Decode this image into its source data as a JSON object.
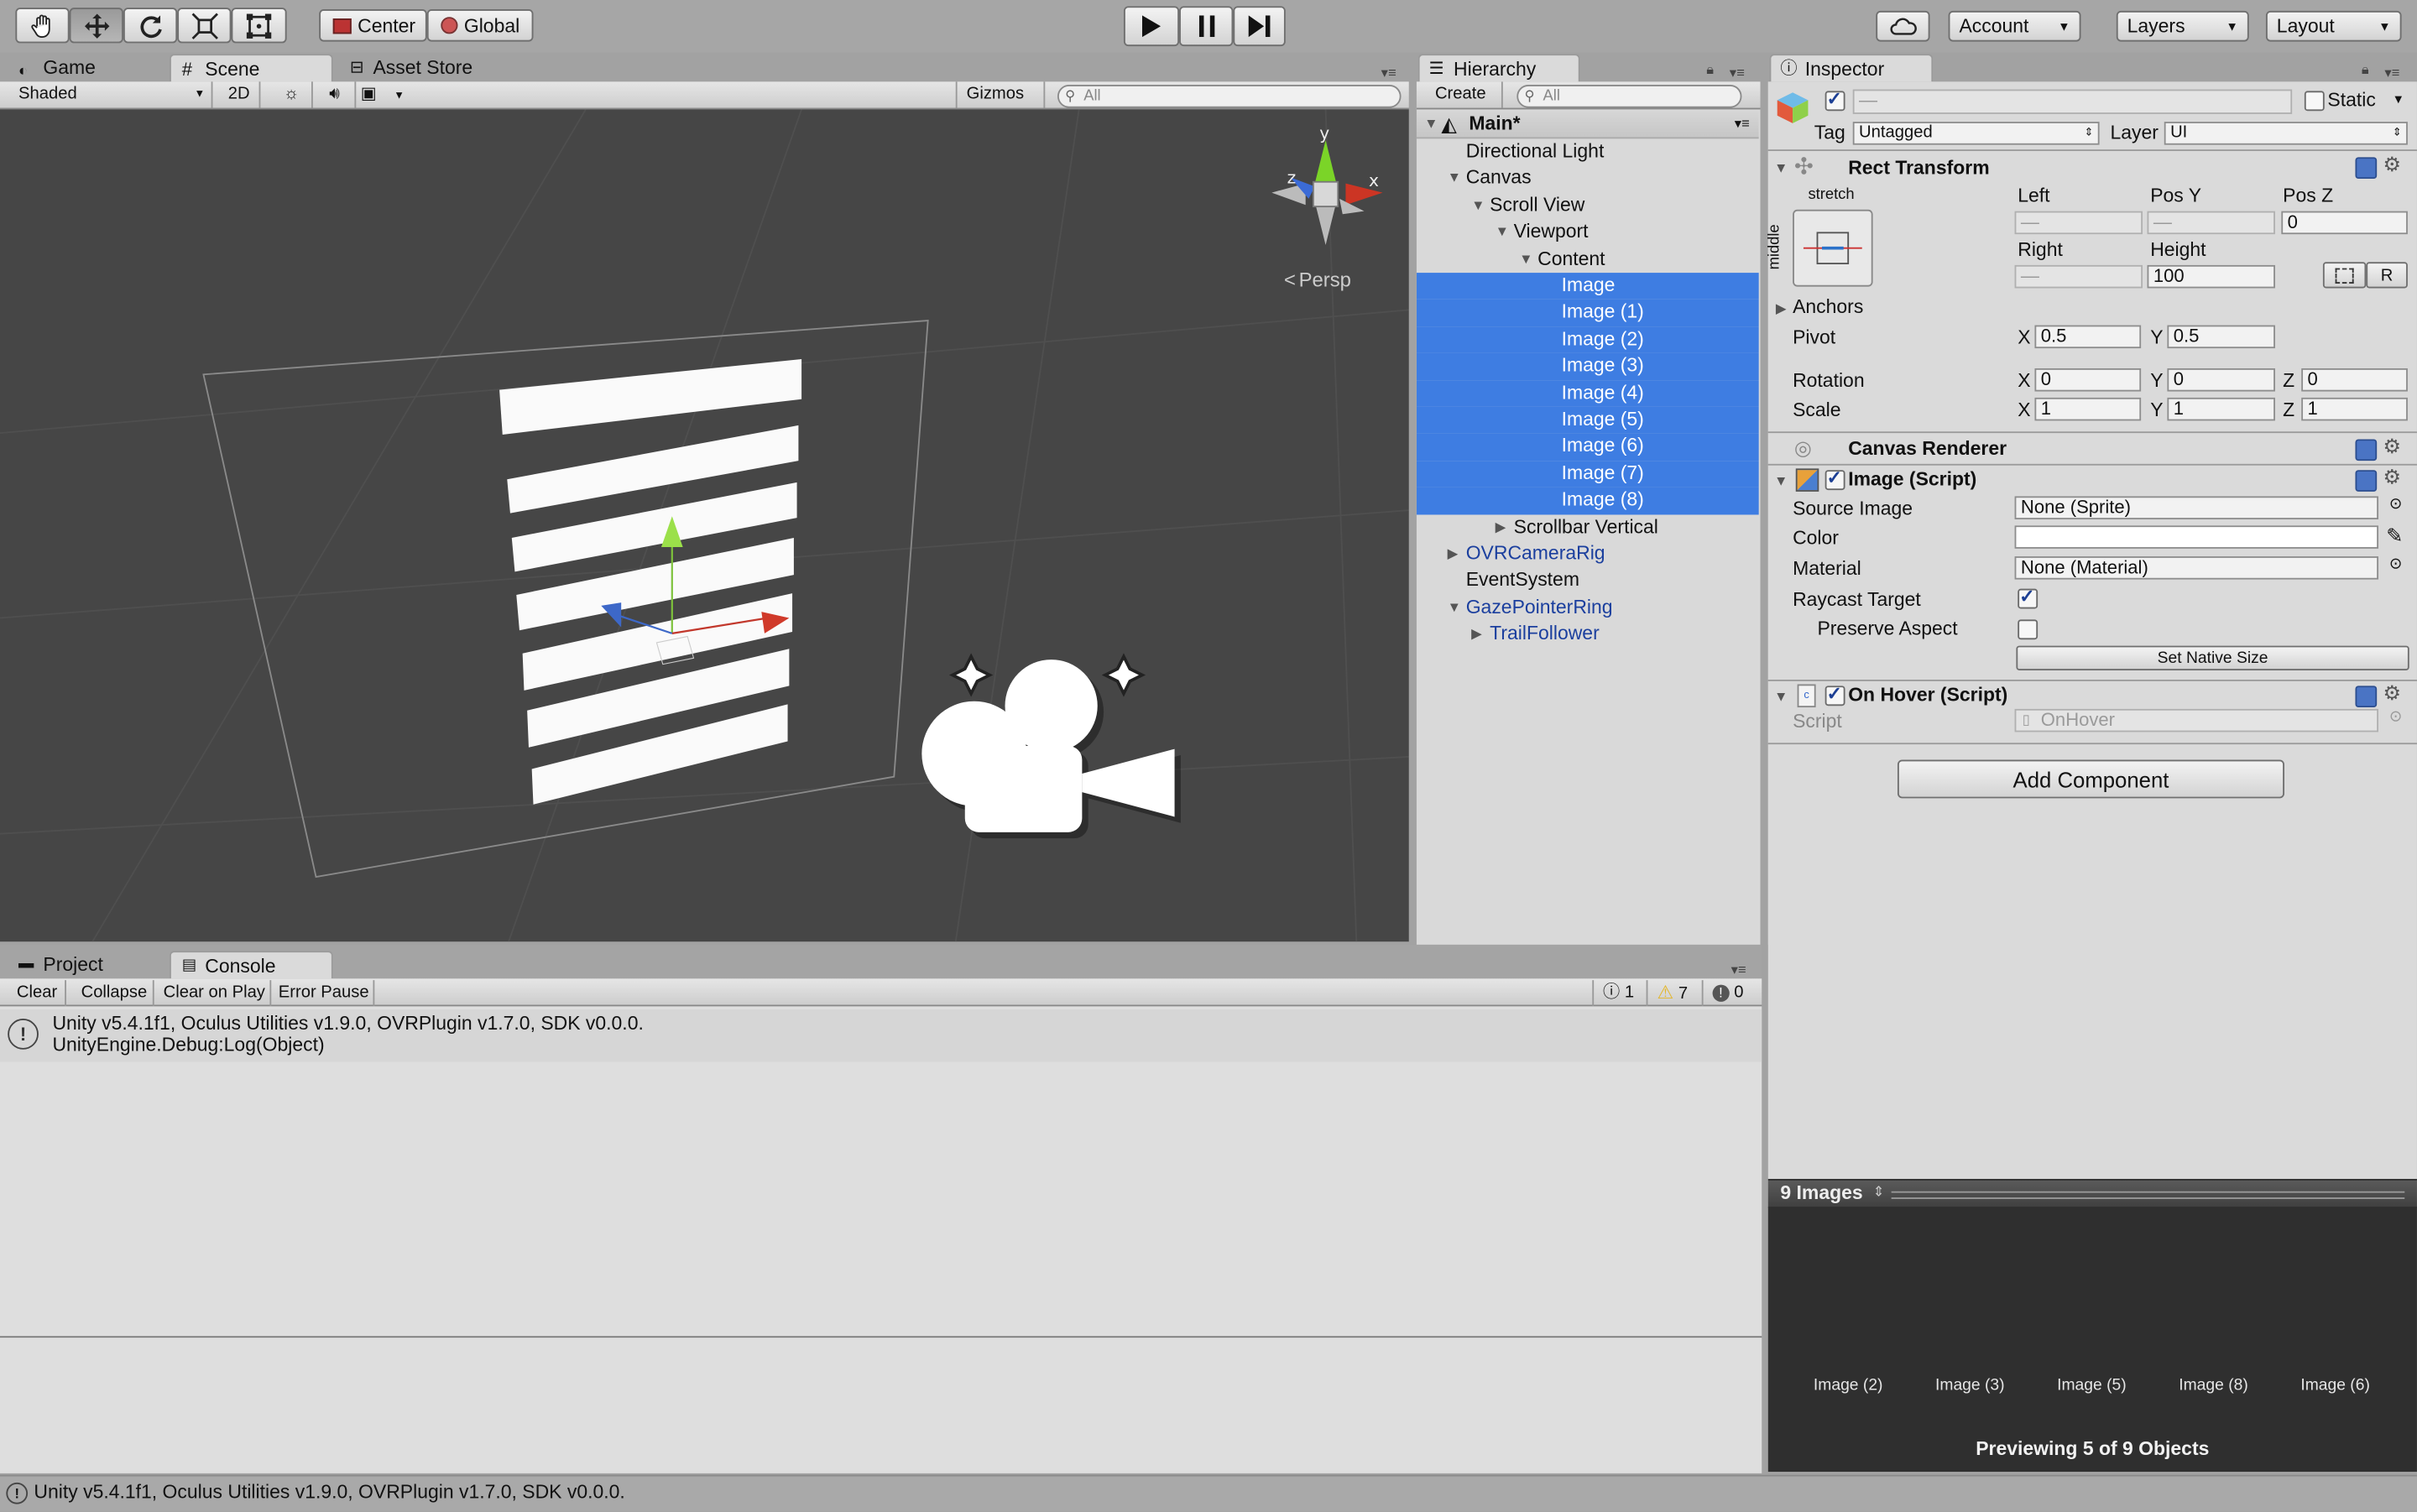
{
  "toolbar": {
    "pivot_label": "Center",
    "space_label": "Global",
    "account_label": "Account",
    "layers_label": "Layers",
    "layout_label": "Layout"
  },
  "scene_panel": {
    "tabs": [
      "Game",
      "Scene",
      "Asset Store"
    ],
    "shading_mode": "Shaded",
    "mode_2d": "2D",
    "gizmos_label": "Gizmos",
    "search_placeholder": "All",
    "persp_label": "Persp",
    "axis_labels": {
      "x": "x",
      "y": "y",
      "z": "z"
    }
  },
  "hierarchy": {
    "tab_label": "Hierarchy",
    "create_label": "Create",
    "search_placeholder": "All",
    "scene_name": "Main*",
    "items": [
      {
        "label": "Directional Light",
        "depth": 1,
        "expander": "",
        "selected": false,
        "prefab": false
      },
      {
        "label": "Canvas",
        "depth": 1,
        "expander": "open",
        "selected": false,
        "prefab": false
      },
      {
        "label": "Scroll View",
        "depth": 2,
        "expander": "open",
        "selected": false,
        "prefab": false
      },
      {
        "label": "Viewport",
        "depth": 3,
        "expander": "open",
        "selected": false,
        "prefab": false
      },
      {
        "label": "Content",
        "depth": 4,
        "expander": "open",
        "selected": false,
        "prefab": false
      },
      {
        "label": "Image",
        "depth": 5,
        "expander": "",
        "selected": true,
        "prefab": false
      },
      {
        "label": "Image (1)",
        "depth": 5,
        "expander": "",
        "selected": true,
        "prefab": false
      },
      {
        "label": "Image (2)",
        "depth": 5,
        "expander": "",
        "selected": true,
        "prefab": false
      },
      {
        "label": "Image (3)",
        "depth": 5,
        "expander": "",
        "selected": true,
        "prefab": false
      },
      {
        "label": "Image (4)",
        "depth": 5,
        "expander": "",
        "selected": true,
        "prefab": false
      },
      {
        "label": "Image (5)",
        "depth": 5,
        "expander": "",
        "selected": true,
        "prefab": false
      },
      {
        "label": "Image (6)",
        "depth": 5,
        "expander": "",
        "selected": true,
        "prefab": false
      },
      {
        "label": "Image (7)",
        "depth": 5,
        "expander": "",
        "selected": true,
        "prefab": false
      },
      {
        "label": "Image (8)",
        "depth": 5,
        "expander": "",
        "selected": true,
        "prefab": false
      },
      {
        "label": "Scrollbar Vertical",
        "depth": 3,
        "expander": "closed",
        "selected": false,
        "prefab": false
      },
      {
        "label": "OVRCameraRig",
        "depth": 1,
        "expander": "closed",
        "selected": false,
        "prefab": true
      },
      {
        "label": "EventSystem",
        "depth": 1,
        "expander": "",
        "selected": false,
        "prefab": false
      },
      {
        "label": "GazePointerRing",
        "depth": 1,
        "expander": "open",
        "selected": false,
        "prefab": true
      },
      {
        "label": "TrailFollower",
        "depth": 2,
        "expander": "closed",
        "selected": false,
        "prefab": true
      }
    ]
  },
  "inspector": {
    "tab_label": "Inspector",
    "name_value": "—",
    "static_label": "Static",
    "tag_label": "Tag",
    "tag_value": "Untagged",
    "layer_label": "Layer",
    "layer_value": "UI",
    "rect_transform": {
      "title": "Rect Transform",
      "anchor_h": "stretch",
      "anchor_v": "middle",
      "left_label": "Left",
      "left_value": "—",
      "posy_label": "Pos Y",
      "posy_value": "—",
      "posz_label": "Pos Z",
      "posz_value": "0",
      "right_label": "Right",
      "right_value": "—",
      "height_label": "Height",
      "height_value": "100",
      "r_label": "R",
      "anchors_label": "Anchors",
      "pivot_label": "Pivot",
      "pivot_x": "0.5",
      "pivot_y": "0.5",
      "rotation_label": "Rotation",
      "rot_x": "0",
      "rot_y": "0",
      "rot_z": "0",
      "scale_label": "Scale",
      "scale_x": "1",
      "scale_y": "1",
      "scale_z": "1",
      "x": "X",
      "y": "Y",
      "z": "Z"
    },
    "canvas_renderer": {
      "title": "Canvas Renderer"
    },
    "image_script": {
      "title": "Image (Script)",
      "source_image_label": "Source Image",
      "source_image_value": "None (Sprite)",
      "color_label": "Color",
      "material_label": "Material",
      "material_value": "None (Material)",
      "raycast_label": "Raycast Target",
      "preserve_label": "Preserve Aspect",
      "native_size_label": "Set Native Size"
    },
    "on_hover": {
      "title": "On Hover (Script)",
      "script_label": "Script",
      "script_value": "OnHover"
    },
    "add_component_label": "Add Component",
    "preview": {
      "title": "9 Images",
      "items": [
        "Image (2)",
        "Image (3)",
        "Image (5)",
        "Image (8)",
        "Image (6)"
      ],
      "footer": "Previewing 5 of 9 Objects"
    }
  },
  "console": {
    "tabs": [
      "Project",
      "Console"
    ],
    "buttons": [
      "Clear",
      "Collapse",
      "Clear on Play",
      "Error Pause"
    ],
    "count_info": "1",
    "count_warn": "7",
    "count_error": "0",
    "log_line1": "Unity v5.4.1f1, Oculus Utilities v1.9.0, OVRPlugin v1.7.0, SDK v0.0.0.",
    "log_line2": "UnityEngine.Debug:Log(Object)"
  },
  "status_bar": {
    "text": "Unity v5.4.1f1, Oculus Utilities v1.9.0, OVRPlugin v1.7.0, SDK v0.0.0."
  },
  "colors": {
    "selection": "#3e7de2",
    "scene_bg": "#444444",
    "prefab_text": "#1b3f9e"
  }
}
